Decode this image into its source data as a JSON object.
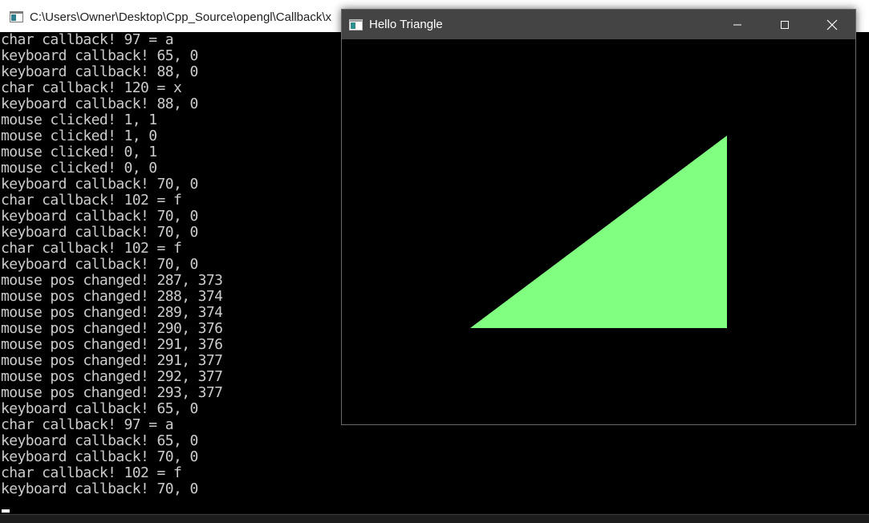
{
  "console": {
    "title": "C:\\Users\\Owner\\Desktop\\Cpp_Source\\opengl\\Callback\\x",
    "lines": [
      "char callback! 97 = a",
      "keyboard callback! 65, 0",
      "keyboard callback! 88, 0",
      "char callback! 120 = x",
      "keyboard callback! 88, 0",
      "mouse clicked! 1, 1",
      "mouse clicked! 1, 0",
      "mouse clicked! 0, 1",
      "mouse clicked! 0, 0",
      "keyboard callback! 70, 0",
      "char callback! 102 = f",
      "keyboard callback! 70, 0",
      "keyboard callback! 70, 0",
      "char callback! 102 = f",
      "keyboard callback! 70, 0",
      "mouse pos changed! 287, 373",
      "mouse pos changed! 288, 374",
      "mouse pos changed! 289, 374",
      "mouse pos changed! 290, 376",
      "mouse pos changed! 291, 376",
      "mouse pos changed! 291, 377",
      "mouse pos changed! 292, 377",
      "mouse pos changed! 293, 377",
      "keyboard callback! 65, 0",
      "char callback! 97 = a",
      "keyboard callback! 65, 0",
      "keyboard callback! 70, 0",
      "char callback! 102 = f",
      "keyboard callback! 70, 0"
    ]
  },
  "gl_window": {
    "title": "Hello Triangle",
    "background_color": "#000000",
    "triangle_color": "#80ff80",
    "icons": {
      "minimize": "minimize-icon",
      "maximize": "maximize-icon",
      "close": "close-icon"
    }
  }
}
